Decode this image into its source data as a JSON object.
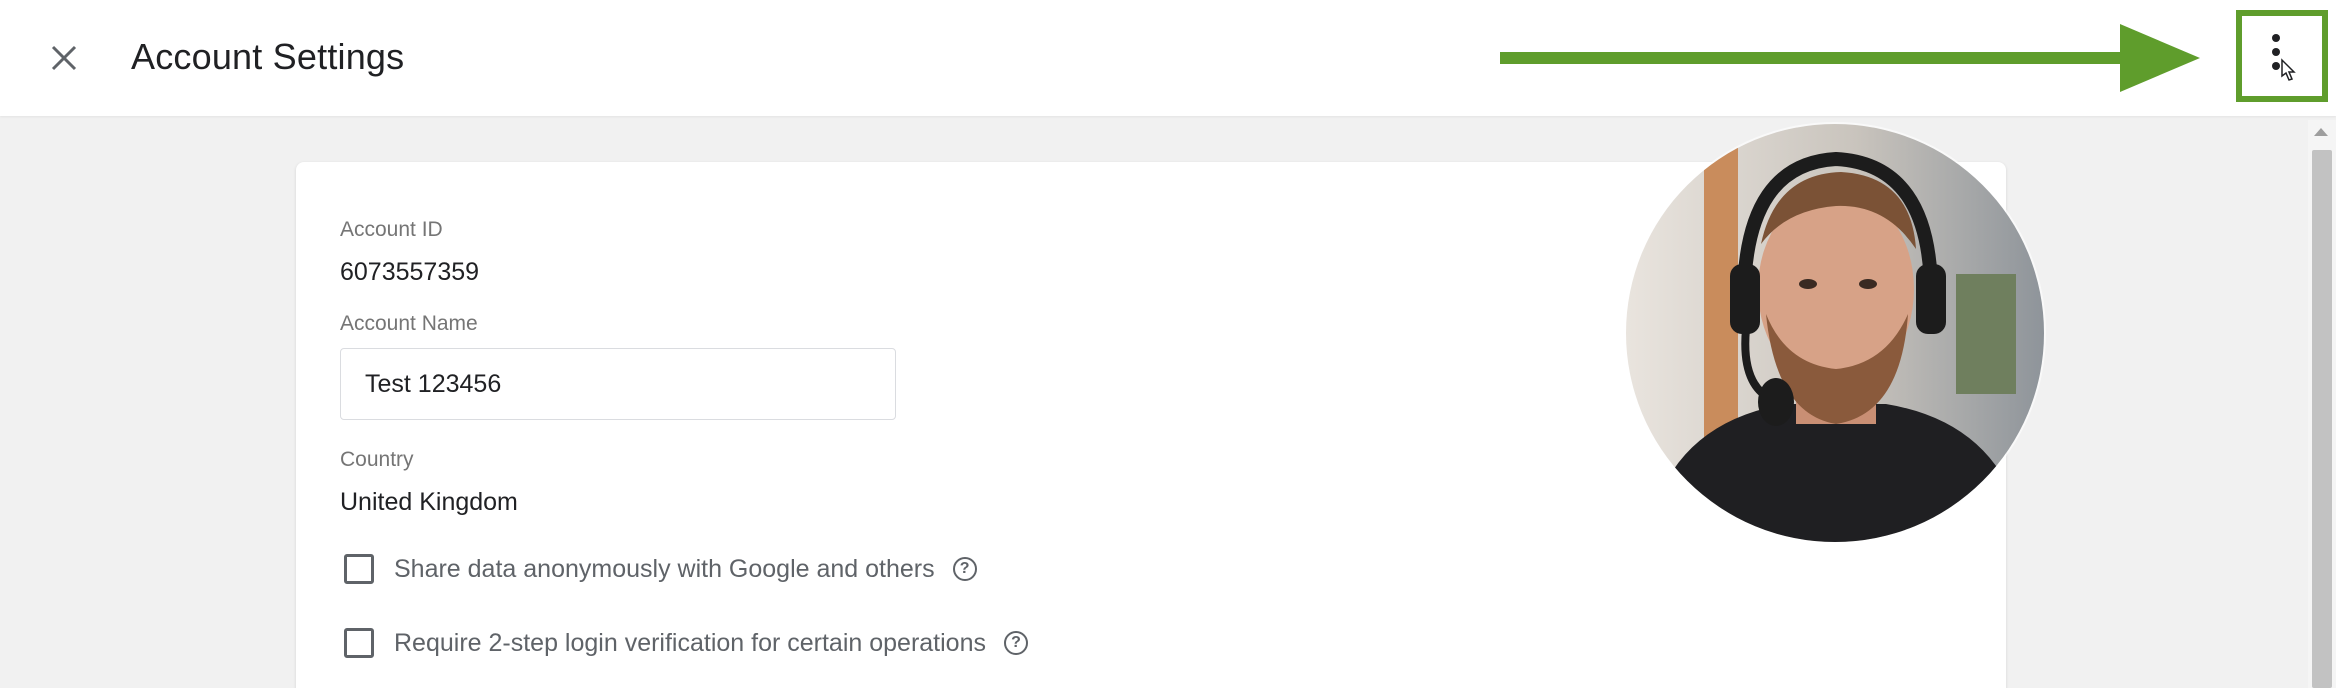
{
  "header": {
    "title": "Account Settings",
    "close_icon": "close-icon",
    "menu_icon": "more-vert-icon"
  },
  "account": {
    "id_label": "Account ID",
    "id_value": "6073557359",
    "name_label": "Account Name",
    "name_value": "Test 123456",
    "country_label": "Country",
    "country_value": "United Kingdom"
  },
  "options": [
    {
      "label": "Share data anonymously with Google and others",
      "checked": false
    },
    {
      "label": "Require 2-step login verification for certain operations",
      "checked": false
    }
  ],
  "colors": {
    "annotation_green": "#5f9d2c",
    "card_bg": "#ffffff",
    "page_bg": "#f1f1f1"
  }
}
